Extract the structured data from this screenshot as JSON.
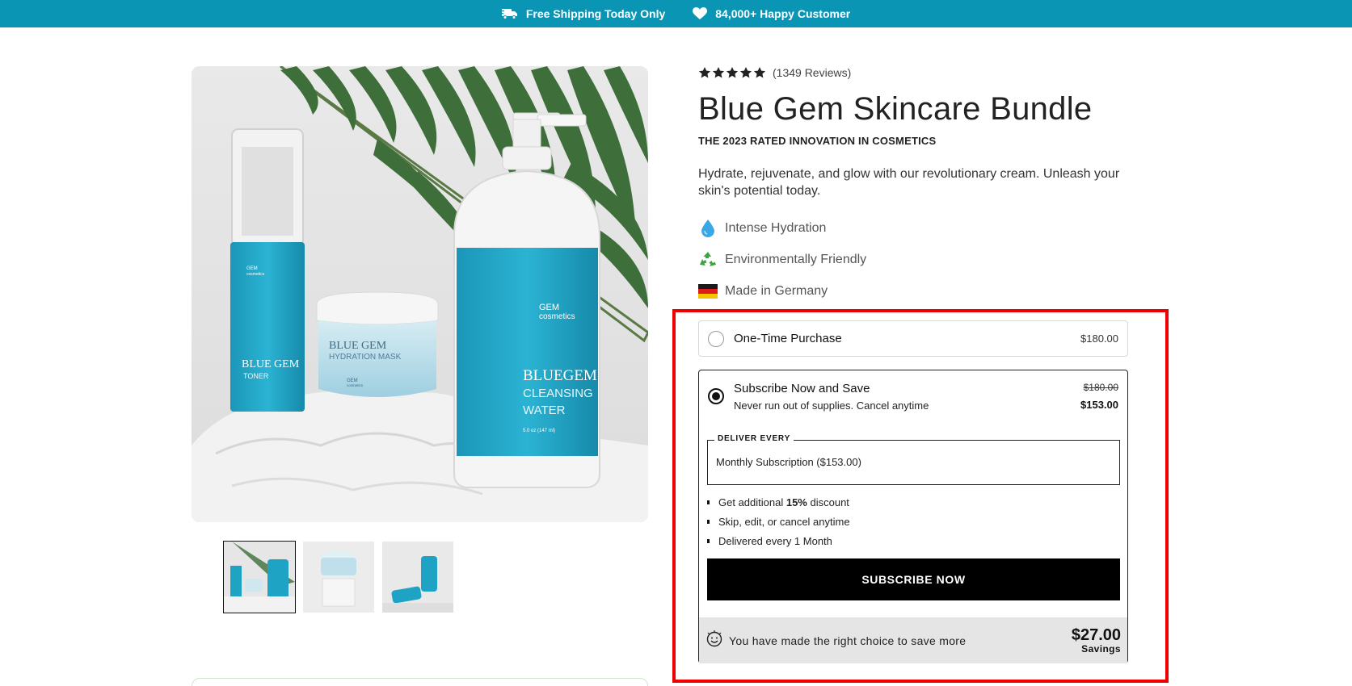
{
  "announcement": {
    "shipping_icon": "truck-icon",
    "shipping_text": "Free Shipping Today Only",
    "customers_icon": "heart-icon",
    "customers_text": "84,000+ Happy Customer"
  },
  "gallery": {
    "main_image_alt": "Blue Gem skincare products",
    "products": {
      "toner_brand": "GEM",
      "toner_brand_sub": "cosmetics",
      "toner_name": "BLUE GEM",
      "toner_type": "TONER",
      "mask_name": "BLUE GEM",
      "mask_type": "HYDRATION MASK",
      "mask_brand": "GEM",
      "mask_brand_sub": "cosmetics",
      "bottle_brand": "GEM",
      "bottle_brand_sub": "cosmetics",
      "bottle_name": "BLUEGEM",
      "bottle_type_1": "CLEANSING",
      "bottle_type_2": "WATER",
      "bottle_size": "5.0 oz (147 ml)"
    },
    "thumbnails": [
      {
        "label": "Bundle thumbnail",
        "active": true
      },
      {
        "label": "Mask thumbnail",
        "active": false
      },
      {
        "label": "Bottles thumbnail",
        "active": false
      }
    ]
  },
  "product": {
    "rating_stars": 5,
    "reviews_text": "(1349 Reviews)",
    "title": "Blue Gem Skincare Bundle",
    "subtitle": "THE 2023 RATED INNOVATION IN COSMETICS",
    "description": "Hydrate, rejuvenate, and glow with our revolutionary cream. Unleash your skin's potential today.",
    "features": [
      {
        "icon": "water-drop-icon",
        "label": "Intense Hydration"
      },
      {
        "icon": "recycle-icon",
        "label": "Environmentally Friendly"
      },
      {
        "icon": "germany-flag-icon",
        "label": "Made in Germany"
      }
    ]
  },
  "purchase": {
    "one_time": {
      "label": "One-Time Purchase",
      "price": "$180.00",
      "selected": false
    },
    "subscribe": {
      "label": "Subscribe Now and Save",
      "note": "Never run out of supplies. Cancel anytime",
      "price_old": "$180.00",
      "price_new": "$153.00",
      "selected": true,
      "deliver_legend": "DELIVER EVERY",
      "deliver_value": "Monthly Subscription ($153.00)",
      "benefit_1_pre": "Get additional ",
      "benefit_1_bold": "15%",
      "benefit_1_post": " discount",
      "benefit_2": "Skip, edit, or cancel anytime",
      "benefit_3": "Delivered every 1 Month",
      "button_label": "SUBSCRIBE NOW"
    },
    "savings": {
      "icon": "smiley-icon",
      "message": "You have made the right choice to save more",
      "amount": "$27.00",
      "amount_label": "Savings"
    }
  },
  "colors": {
    "announcement_bg": "#0b95b4",
    "highlight_border": "#ee0000",
    "button_bg": "#000000",
    "product_teal": "#1ea3c4"
  }
}
